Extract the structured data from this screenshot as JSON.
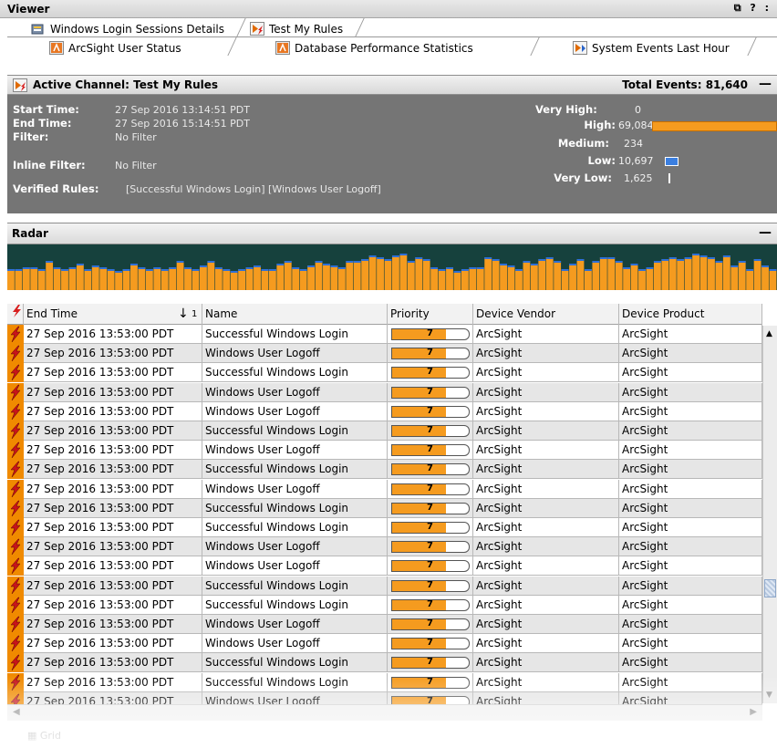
{
  "viewer": {
    "title": "Viewer",
    "controls": "⧉ ? :"
  },
  "tabs_row1": [
    {
      "label": "Windows Login Sessions Details",
      "icon": "dashboard-icon"
    },
    {
      "label": "Test My Rules",
      "icon": "active-channel-icon"
    }
  ],
  "tabs_row2": [
    {
      "label": "ArcSight User Status",
      "icon": "arcsight-icon"
    },
    {
      "label": "Database Performance Statistics",
      "icon": "arcsight-icon"
    },
    {
      "label": "System Events Last Hour",
      "icon": "channel-icon"
    }
  ],
  "channel": {
    "title": "Active Channel: Test My Rules",
    "total_label": "Total Events:",
    "total_value": "81,640",
    "start_time_label": "Start Time:",
    "start_time": "27 Sep 2016 13:14:51 PDT",
    "end_time_label": "End Time:",
    "end_time": "27 Sep 2016 15:14:51 PDT",
    "filter_label": "Filter:",
    "filter": "No Filter",
    "inline_filter_label": "Inline Filter:",
    "inline_filter": "No Filter",
    "verified_rules_label": "Verified Rules:",
    "verified_rules": "[Successful Windows Login] [Windows User Logoff]",
    "severity": [
      {
        "label": "Very High:",
        "value": "0"
      },
      {
        "label": "High:",
        "value": "69,084"
      },
      {
        "label": "Medium:",
        "value": "234"
      },
      {
        "label": "Low:",
        "value": "10,697"
      },
      {
        "label": "Very Low:",
        "value": "1,625"
      }
    ]
  },
  "radar": {
    "title": "Radar",
    "bars": [
      0.55,
      0.55,
      0.6,
      0.6,
      0.55,
      0.75,
      0.6,
      0.55,
      0.6,
      0.7,
      0.55,
      0.65,
      0.6,
      0.55,
      0.5,
      0.55,
      0.7,
      0.6,
      0.55,
      0.6,
      0.55,
      0.6,
      0.75,
      0.6,
      0.55,
      0.65,
      0.75,
      0.6,
      0.55,
      0.5,
      0.55,
      0.6,
      0.65,
      0.55,
      0.55,
      0.7,
      0.75,
      0.6,
      0.55,
      0.65,
      0.75,
      0.7,
      0.65,
      0.6,
      0.75,
      0.75,
      0.8,
      0.9,
      0.85,
      0.8,
      0.9,
      0.95,
      0.75,
      0.85,
      0.8,
      0.6,
      0.55,
      0.6,
      0.5,
      0.55,
      0.6,
      0.6,
      0.85,
      0.8,
      0.7,
      0.65,
      0.55,
      0.75,
      0.7,
      0.8,
      0.85,
      0.75,
      0.55,
      0.7,
      0.8,
      0.55,
      0.75,
      0.85,
      0.85,
      0.75,
      0.6,
      0.7,
      0.55,
      0.6,
      0.75,
      0.8,
      0.85,
      0.8,
      0.85,
      0.95,
      0.9,
      0.85,
      0.75,
      0.9,
      0.65,
      0.75,
      0.55,
      0.8,
      0.65,
      0.55
    ],
    "colors": {
      "bar": "#f59b1f",
      "bar_top": "#2d6fd8",
      "background": "#16413d"
    }
  },
  "grid": {
    "columns": [
      {
        "key": "end_time",
        "label": "End Time",
        "sort": "↓",
        "sort_index": "1"
      },
      {
        "key": "name",
        "label": "Name"
      },
      {
        "key": "priority",
        "label": "Priority"
      },
      {
        "key": "vendor",
        "label": "Device Vendor"
      },
      {
        "key": "product",
        "label": "Device Product"
      }
    ],
    "rows": [
      {
        "end_time": "27 Sep 2016 13:53:00 PDT",
        "name": "Successful Windows Login",
        "priority": 7,
        "vendor": "ArcSight",
        "product": "ArcSight"
      },
      {
        "end_time": "27 Sep 2016 13:53:00 PDT",
        "name": "Windows User Logoff",
        "priority": 7,
        "vendor": "ArcSight",
        "product": "ArcSight"
      },
      {
        "end_time": "27 Sep 2016 13:53:00 PDT",
        "name": "Successful Windows Login",
        "priority": 7,
        "vendor": "ArcSight",
        "product": "ArcSight"
      },
      {
        "end_time": "27 Sep 2016 13:53:00 PDT",
        "name": "Windows User Logoff",
        "priority": 7,
        "vendor": "ArcSight",
        "product": "ArcSight"
      },
      {
        "end_time": "27 Sep 2016 13:53:00 PDT",
        "name": "Windows User Logoff",
        "priority": 7,
        "vendor": "ArcSight",
        "product": "ArcSight"
      },
      {
        "end_time": "27 Sep 2016 13:53:00 PDT",
        "name": "Successful Windows Login",
        "priority": 7,
        "vendor": "ArcSight",
        "product": "ArcSight"
      },
      {
        "end_time": "27 Sep 2016 13:53:00 PDT",
        "name": "Windows User Logoff",
        "priority": 7,
        "vendor": "ArcSight",
        "product": "ArcSight"
      },
      {
        "end_time": "27 Sep 2016 13:53:00 PDT",
        "name": "Successful Windows Login",
        "priority": 7,
        "vendor": "ArcSight",
        "product": "ArcSight"
      },
      {
        "end_time": "27 Sep 2016 13:53:00 PDT",
        "name": "Windows User Logoff",
        "priority": 7,
        "vendor": "ArcSight",
        "product": "ArcSight"
      },
      {
        "end_time": "27 Sep 2016 13:53:00 PDT",
        "name": "Successful Windows Login",
        "priority": 7,
        "vendor": "ArcSight",
        "product": "ArcSight"
      },
      {
        "end_time": "27 Sep 2016 13:53:00 PDT",
        "name": "Successful Windows Login",
        "priority": 7,
        "vendor": "ArcSight",
        "product": "ArcSight"
      },
      {
        "end_time": "27 Sep 2016 13:53:00 PDT",
        "name": "Windows User Logoff",
        "priority": 7,
        "vendor": "ArcSight",
        "product": "ArcSight"
      },
      {
        "end_time": "27 Sep 2016 13:53:00 PDT",
        "name": "Windows User Logoff",
        "priority": 7,
        "vendor": "ArcSight",
        "product": "ArcSight"
      },
      {
        "end_time": "27 Sep 2016 13:53:00 PDT",
        "name": "Successful Windows Login",
        "priority": 7,
        "vendor": "ArcSight",
        "product": "ArcSight"
      },
      {
        "end_time": "27 Sep 2016 13:53:00 PDT",
        "name": "Successful Windows Login",
        "priority": 7,
        "vendor": "ArcSight",
        "product": "ArcSight"
      },
      {
        "end_time": "27 Sep 2016 13:53:00 PDT",
        "name": "Windows User Logoff",
        "priority": 7,
        "vendor": "ArcSight",
        "product": "ArcSight"
      },
      {
        "end_time": "27 Sep 2016 13:53:00 PDT",
        "name": "Windows User Logoff",
        "priority": 7,
        "vendor": "ArcSight",
        "product": "ArcSight"
      },
      {
        "end_time": "27 Sep 2016 13:53:00 PDT",
        "name": "Successful Windows Login",
        "priority": 7,
        "vendor": "ArcSight",
        "product": "ArcSight"
      },
      {
        "end_time": "27 Sep 2016 13:53:00 PDT",
        "name": "Successful Windows Login",
        "priority": 7,
        "vendor": "ArcSight",
        "product": "ArcSight"
      },
      {
        "end_time": "27 Sep 2016 13:53:00 PDT",
        "name": "Windows User Logoff",
        "priority": 7,
        "vendor": "ArcSight",
        "product": "ArcSight"
      }
    ],
    "priority_max": 10,
    "row_colors": {
      "odd": "#ffffff",
      "even": "#e6e6e6",
      "flag": "#f08a00"
    }
  },
  "bottom_tab": {
    "label": "Grid"
  }
}
